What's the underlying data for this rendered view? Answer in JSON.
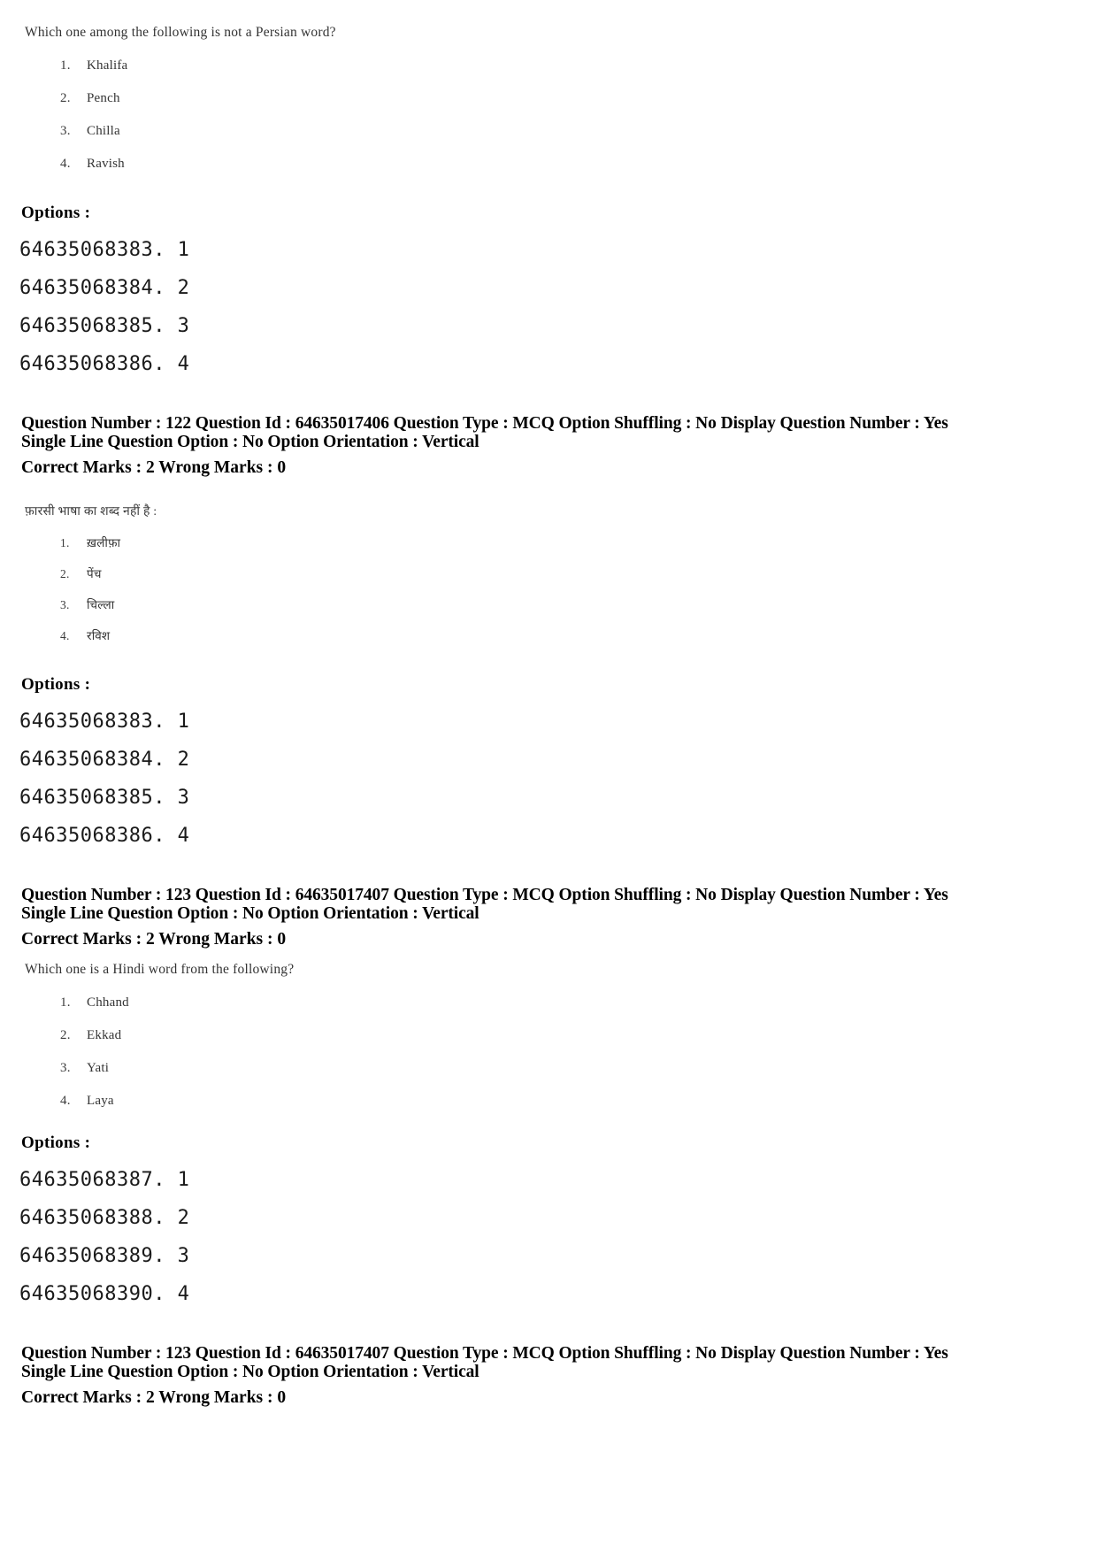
{
  "document": {
    "type": "exam-answer-key-page",
    "options_label": "Options :"
  },
  "blocks": {
    "q122_en": {
      "stem": "Which one among the following is not a Persian word?",
      "choices": [
        {
          "num": "1.",
          "text": "Khalifa"
        },
        {
          "num": "2.",
          "text": "Pench"
        },
        {
          "num": "3.",
          "text": "Chilla"
        },
        {
          "num": "4.",
          "text": "Ravish"
        }
      ],
      "options_label": "Options :",
      "option_ids": [
        "64635068383. 1",
        "64635068384. 2",
        "64635068385. 3",
        "64635068386. 4"
      ]
    },
    "q122_meta": {
      "line1": "Question Number : 122  Question Id : 64635017406  Question Type : MCQ  Option Shuffling : No  Display Question Number : Yes",
      "line2": "Single Line Question Option : No  Option Orientation : Vertical",
      "marks": "Correct Marks : 2  Wrong Marks : 0"
    },
    "q122_hi": {
      "stem": "फ़ारसी भाषा का शब्द नहीं है :",
      "choices": [
        {
          "num": "1.",
          "text": "ख़लीफ़ा"
        },
        {
          "num": "2.",
          "text": "पेंच"
        },
        {
          "num": "3.",
          "text": "चिल्ला"
        },
        {
          "num": "4.",
          "text": "रविश"
        }
      ],
      "options_label": "Options :",
      "option_ids": [
        "64635068383. 1",
        "64635068384. 2",
        "64635068385. 3",
        "64635068386. 4"
      ]
    },
    "q123_meta_top": {
      "line1": "Question Number : 123  Question Id : 64635017407  Question Type : MCQ  Option Shuffling : No  Display Question Number : Yes",
      "line2": "Single Line Question Option : No  Option Orientation : Vertical",
      "marks": "Correct Marks : 2  Wrong Marks : 0"
    },
    "q123_en": {
      "stem": "Which one is a Hindi word from the following?",
      "choices": [
        {
          "num": "1.",
          "text": "Chhand"
        },
        {
          "num": "2.",
          "text": "Ekkad"
        },
        {
          "num": "3.",
          "text": "Yati"
        },
        {
          "num": "4.",
          "text": "Laya"
        }
      ],
      "options_label": "Options :",
      "option_ids": [
        "64635068387. 1",
        "64635068388. 2",
        "64635068389. 3",
        "64635068390. 4"
      ]
    },
    "q123_meta_bottom": {
      "line1": "Question Number : 123  Question Id : 64635017407  Question Type : MCQ  Option Shuffling : No  Display Question Number : Yes",
      "line2": "Single Line Question Option : No  Option Orientation : Vertical",
      "marks": "Correct Marks : 2  Wrong Marks : 0"
    }
  }
}
